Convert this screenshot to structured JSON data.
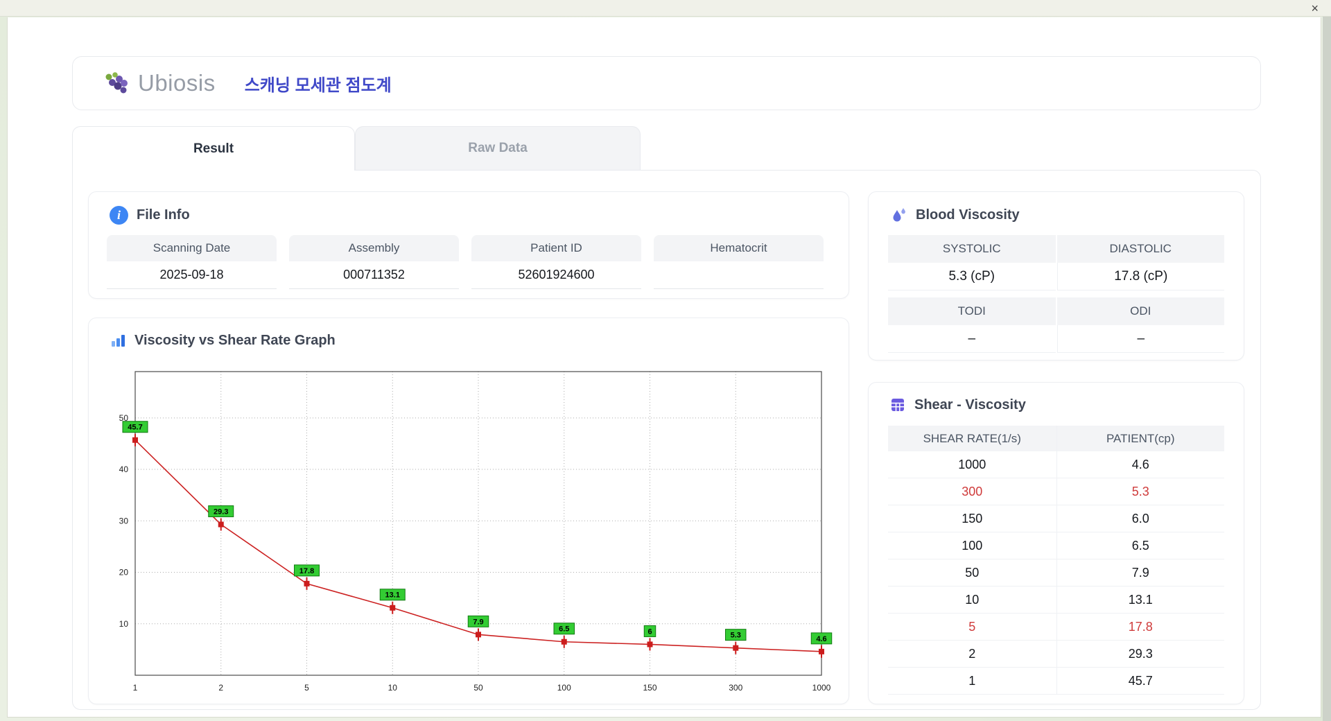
{
  "window": {
    "close_label": "×"
  },
  "header": {
    "logo_text": "Ubiosis",
    "title": "스캐닝 모세관 점도계"
  },
  "tabs": [
    {
      "label": "Result"
    },
    {
      "label": "Raw Data"
    }
  ],
  "file_info": {
    "title": "File Info",
    "fields": [
      {
        "label": "Scanning Date",
        "value": "2025-09-18"
      },
      {
        "label": "Assembly",
        "value": "000711352"
      },
      {
        "label": "Patient ID",
        "value": "52601924600"
      },
      {
        "label": "Hematocrit",
        "value": ""
      }
    ]
  },
  "blood_viscosity": {
    "title": "Blood Viscosity",
    "row1": [
      {
        "label": "SYSTOLIC",
        "value": "5.3 (cP)"
      },
      {
        "label": "DIASTOLIC",
        "value": "17.8 (cP)"
      }
    ],
    "row2": [
      {
        "label": "TODI",
        "value": "–"
      },
      {
        "label": "ODI",
        "value": "–"
      }
    ]
  },
  "shear_viscosity": {
    "title": "Shear - Viscosity",
    "columns": [
      "SHEAR RATE(1/s)",
      "PATIENT(cp)"
    ],
    "rows": [
      {
        "shear": "1000",
        "patient": "4.6",
        "highlight": false
      },
      {
        "shear": "300",
        "patient": "5.3",
        "highlight": true
      },
      {
        "shear": "150",
        "patient": "6.0",
        "highlight": false
      },
      {
        "shear": "100",
        "patient": "6.5",
        "highlight": false
      },
      {
        "shear": "50",
        "patient": "7.9",
        "highlight": false
      },
      {
        "shear": "10",
        "patient": "13.1",
        "highlight": false
      },
      {
        "shear": "5",
        "patient": "17.8",
        "highlight": true
      },
      {
        "shear": "2",
        "patient": "29.3",
        "highlight": false
      },
      {
        "shear": "1",
        "patient": "45.7",
        "highlight": false
      }
    ]
  },
  "chart_data": {
    "type": "line",
    "title": "Viscosity vs Shear Rate Graph",
    "x_categories": [
      "1",
      "2",
      "5",
      "10",
      "50",
      "100",
      "150",
      "300",
      "1000"
    ],
    "values": [
      45.7,
      29.3,
      17.8,
      13.1,
      7.9,
      6.5,
      6,
      5.3,
      4.6
    ],
    "point_labels": [
      "45.7",
      "29.3",
      "17.8",
      "13.1",
      "7.9",
      "6.5",
      "6",
      "5.3",
      "4.6"
    ],
    "yticks": [
      10,
      20,
      30,
      40,
      50
    ],
    "ylim": [
      0,
      59
    ],
    "x_scale": "categorical-even-spacing",
    "grid": "dotted",
    "legend": "none",
    "line_color": "#cc2222",
    "marker_color": "#cc1d1d",
    "point_label_bg": "#33cc33",
    "point_label_border": "#117a11",
    "point_label_text": "#000000"
  }
}
